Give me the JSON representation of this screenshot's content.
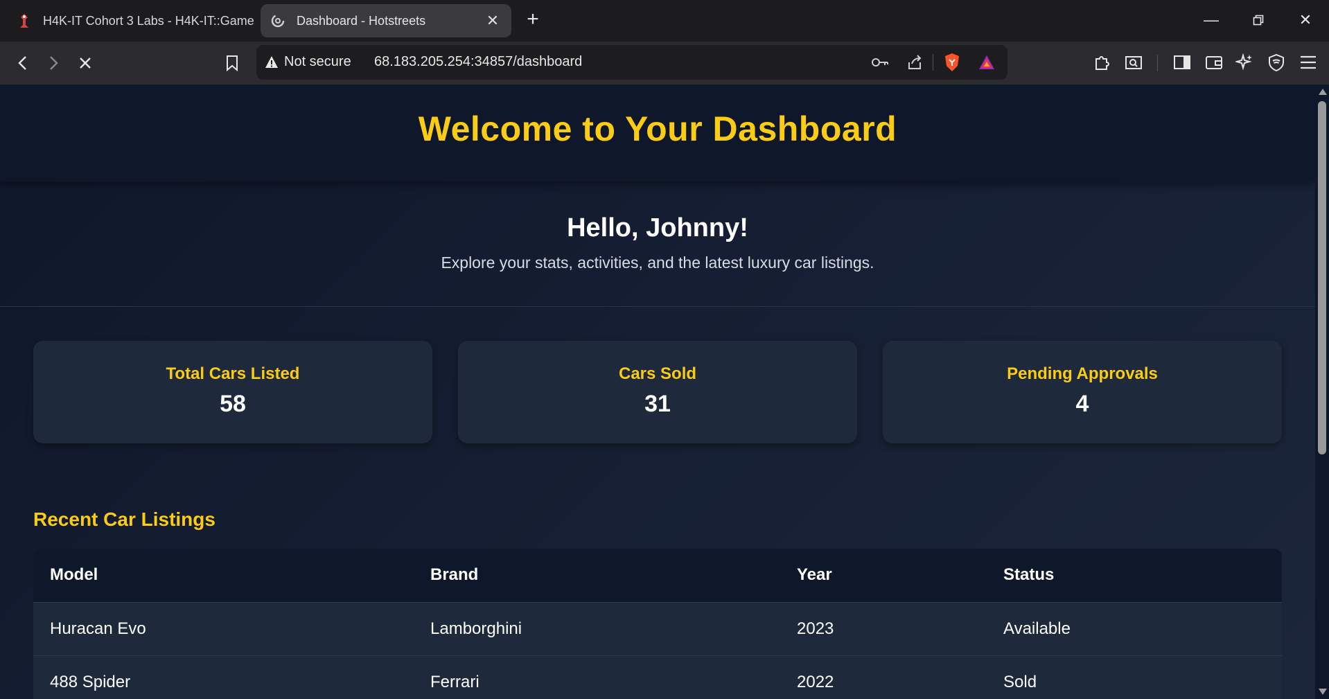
{
  "browser": {
    "tabs": [
      {
        "title": "H4K-IT Cohort 3 Labs - H4K-IT::Game",
        "active": false,
        "icon": "h4k-favicon"
      },
      {
        "title": "Dashboard - Hotstreets",
        "active": true,
        "icon": "loading-spinner-icon"
      }
    ],
    "security_label": "Not secure",
    "url_host": "68.183.205.254",
    "url_path": ":34857/dashboard"
  },
  "page": {
    "header_title": "Welcome to Your Dashboard",
    "greeting": "Hello, Johnny!",
    "subtitle": "Explore your stats, activities, and the latest luxury car listings.",
    "accent_color": "#facc15",
    "stats": [
      {
        "label": "Total Cars Listed",
        "value": "58"
      },
      {
        "label": "Cars Sold",
        "value": "31"
      },
      {
        "label": "Pending Approvals",
        "value": "4"
      }
    ],
    "listings_title": "Recent Car Listings",
    "table": {
      "headers": [
        "Model",
        "Brand",
        "Year",
        "Status"
      ],
      "rows": [
        [
          "Huracan Evo",
          "Lamborghini",
          "2023",
          "Available"
        ],
        [
          "488 Spider",
          "Ferrari",
          "2022",
          "Sold"
        ]
      ]
    }
  }
}
